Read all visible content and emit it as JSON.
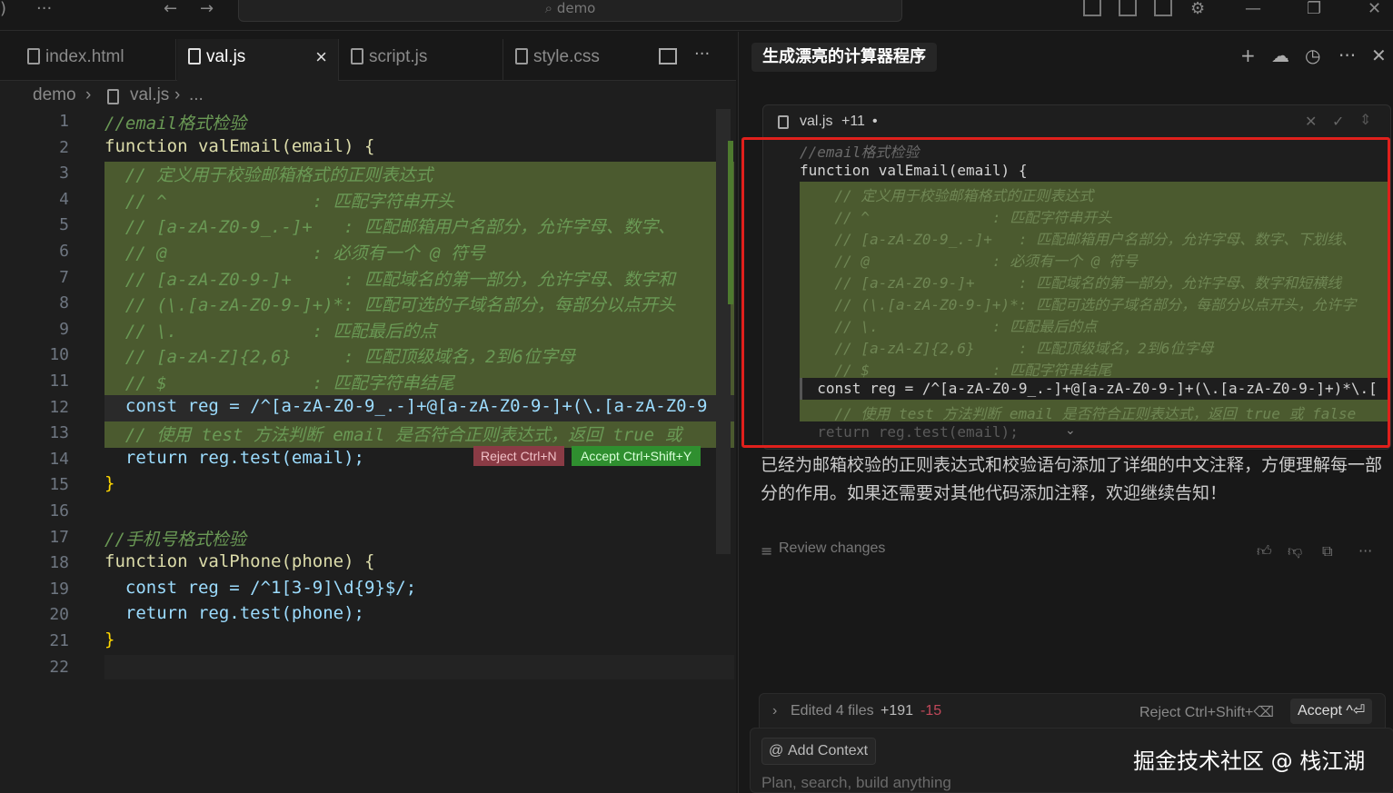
{
  "titlebar": {
    "search_text": "demo",
    "more": "···",
    "back": "←",
    "forward": "→"
  },
  "editor": {
    "tabs": [
      {
        "label": "index.html",
        "active": false
      },
      {
        "label": "val.js",
        "active": true
      },
      {
        "label": "script.js",
        "active": false
      },
      {
        "label": "style.css",
        "active": false
      }
    ],
    "tab_close": "×",
    "more": "···",
    "breadcrumb": {
      "folder": "demo",
      "file": "val.js",
      "tail": "..."
    },
    "lines": [
      {
        "n": "1",
        "text": "//email格式检验"
      },
      {
        "n": "2",
        "text": "function valEmail(email) {"
      },
      {
        "n": "3",
        "text": "  // 定义用于校验邮箱格式的正则表达式"
      },
      {
        "n": "4",
        "text": "  // ^              : 匹配字符串开头"
      },
      {
        "n": "5",
        "text": "  // [a-zA-Z0-9_.-]+   : 匹配邮箱用户名部分，允许字母、数字、"
      },
      {
        "n": "6",
        "text": "  // @              : 必须有一个 @ 符号"
      },
      {
        "n": "7",
        "text": "  // [a-zA-Z0-9-]+     : 匹配域名的第一部分，允许字母、数字和"
      },
      {
        "n": "8",
        "text": "  // (\\.[a-zA-Z0-9-]+)*: 匹配可选的子域名部分，每部分以点开头"
      },
      {
        "n": "9",
        "text": "  // \\.             : 匹配最后的点"
      },
      {
        "n": "10",
        "text": "  // [a-zA-Z]{2,6}     : 匹配顶级域名，2到6位字母"
      },
      {
        "n": "11",
        "text": "  // $              : 匹配字符串结尾"
      },
      {
        "n": "12",
        "text": "  const reg = /^[a-zA-Z0-9_.-]+@[a-zA-Z0-9-]+(\\.[a-zA-Z0-9"
      },
      {
        "n": "13",
        "text": "  // 使用 test 方法判断 email 是否符合正则表达式，返回 true 或"
      },
      {
        "n": "14",
        "text": "  return reg.test(email);"
      },
      {
        "n": "15",
        "text": "}"
      },
      {
        "n": "16",
        "text": ""
      },
      {
        "n": "17",
        "text": "//手机号格式检验"
      },
      {
        "n": "18",
        "text": "function valPhone(phone) {"
      },
      {
        "n": "19",
        "text": "  const reg = /^1[3-9]\\d{9}$/;"
      },
      {
        "n": "20",
        "text": "  return reg.test(phone);"
      },
      {
        "n": "21",
        "text": "}"
      },
      {
        "n": "22",
        "text": ""
      }
    ],
    "reject_label": "Reject Ctrl+N",
    "accept_label": "Accept Ctrl+Shift+Y"
  },
  "chat": {
    "title": "生成漂亮的计算器程序",
    "diff_file": "val.js",
    "diff_count": "+11",
    "diff_dot": "•",
    "diff_lines": [
      "//email格式检验",
      "function valEmail(email) {",
      "    // 定义用于校验邮箱格式的正则表达式",
      "    // ^              : 匹配字符串开头",
      "    // [a-zA-Z0-9_.-]+   : 匹配邮箱用户名部分，允许字母、数字、下划线、",
      "    // @              : 必须有一个 @ 符号",
      "    // [a-zA-Z0-9-]+     : 匹配域名的第一部分，允许字母、数字和短横线",
      "    // (\\.[a-zA-Z0-9-]+)*: 匹配可选的子域名部分，每部分以点开头，允许字",
      "    // \\.             : 匹配最后的点",
      "    // [a-zA-Z]{2,6}     : 匹配顶级域名，2到6位字母",
      "    // $              : 匹配字符串结尾",
      "  const reg = /^[a-zA-Z0-9_.-]+@[a-zA-Z0-9-]+(\\.[a-zA-Z0-9-]+)*\\.[",
      "    // 使用 test 方法判断 email 是否符合正则表达式，返回 true 或 false",
      "  return reg.test(email);"
    ],
    "message": "已经为邮箱校验的正则表达式和校验语句添加了详细的中文注释，方便理解每一部分的作用。如果还需要对其他代码添加注释，欢迎继续告知！",
    "review_label": "Review changes",
    "edited": {
      "label": "Edited 4 files",
      "plus": "+191",
      "minus": "-15",
      "reject": "Reject Ctrl+Shift+⌫",
      "accept": "Accept ^⏎"
    },
    "add_context": "Add Context",
    "placeholder": "Plan, search, build anything"
  },
  "watermark": "掘金技术社区 @ 栈江湖"
}
